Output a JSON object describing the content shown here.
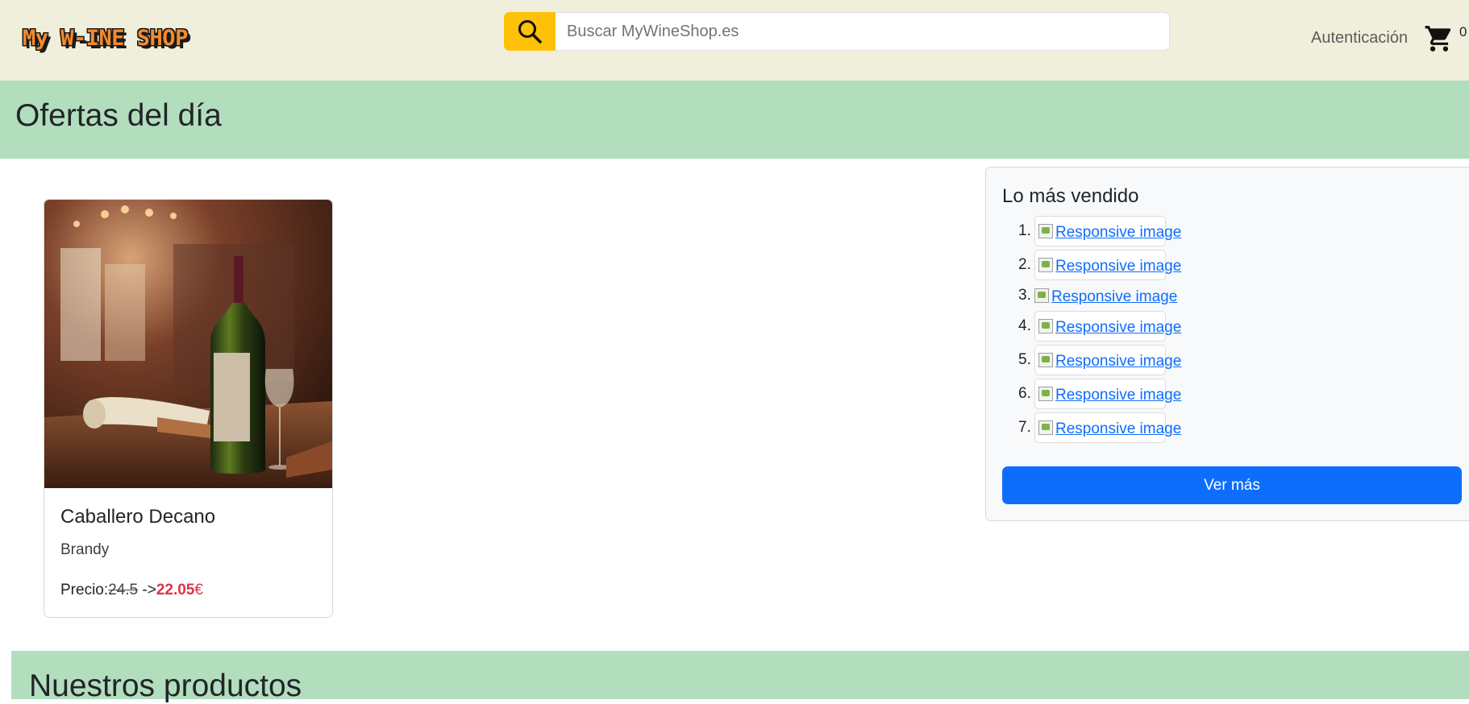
{
  "header": {
    "logo_text": "My W-INE SHOP",
    "search_placeholder": "Buscar MyWineShop.es",
    "search_icon": "search-icon",
    "auth_label": "Autenticación",
    "cart_icon": "shopping-cart-icon",
    "cart_count": "0"
  },
  "offers": {
    "title": "Ofertas del día",
    "product": {
      "name": "Caballero Decano",
      "category": "Brandy",
      "price_label": "Precio:",
      "old_price": "24.5",
      "arrow": " ->",
      "new_price": "22.05",
      "currency": "€"
    }
  },
  "best_sellers": {
    "title": "Lo más vendido",
    "items": [
      {
        "num": "1.",
        "alt": "Responsive image"
      },
      {
        "num": "2.",
        "alt": "Responsive image"
      },
      {
        "num": "3.",
        "alt": "Responsive image"
      },
      {
        "num": "4.",
        "alt": "Responsive image"
      },
      {
        "num": "5.",
        "alt": "Responsive image"
      },
      {
        "num": "6.",
        "alt": "Responsive image"
      },
      {
        "num": "7.",
        "alt": "Responsive image"
      }
    ],
    "more_button": "Ver más"
  },
  "products_section": {
    "title": "Nuestros productos"
  },
  "colors": {
    "navbar_bg": "#efefdb",
    "band_bg": "#b3debd",
    "search_button": "#ffc107",
    "primary": "#0d6efd",
    "price_red": "#dc3545"
  }
}
